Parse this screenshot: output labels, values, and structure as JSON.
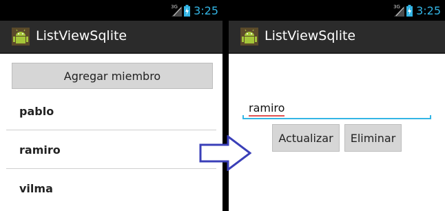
{
  "status": {
    "network_label": "3G",
    "time": "3:25",
    "clock_color": "#33b5e5"
  },
  "app": {
    "title": "ListViewSqlite",
    "icon": "android-robot-icon"
  },
  "list_screen": {
    "add_button_label": "Agregar miembro",
    "members": [
      "pablo",
      "ramiro",
      "vilma"
    ]
  },
  "detail_screen": {
    "name_value": "ramiro",
    "update_label": "Actualizar",
    "delete_label": "Eliminar",
    "accent": "#33b5e5"
  },
  "transition_arrow": {
    "icon": "right-arrow-icon",
    "color": "#3a3fb8"
  }
}
